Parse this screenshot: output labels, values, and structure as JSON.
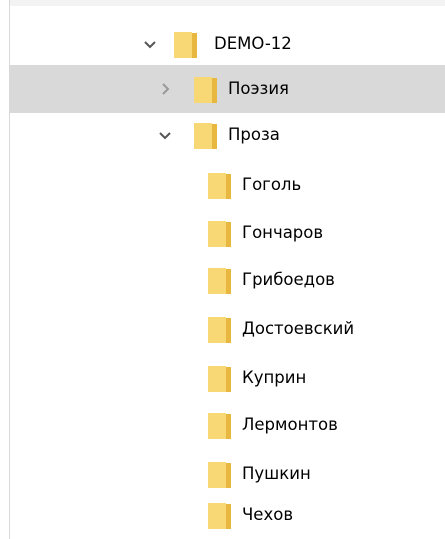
{
  "colors": {
    "selected_row": "#d9d9d9",
    "folder_fill": "#f8d775",
    "folder_tab": "#e8b73f",
    "chevron": "#555555"
  },
  "tree": {
    "root": {
      "label": "DEMO-12",
      "expanded": true
    },
    "poetry": {
      "label": "Поэзия",
      "expanded": false,
      "selected": true
    },
    "prose": {
      "label": "Проза",
      "expanded": true,
      "children": [
        {
          "label": "Гоголь"
        },
        {
          "label": "Гончаров"
        },
        {
          "label": "Грибоедов"
        },
        {
          "label": "Достоевский"
        },
        {
          "label": "Куприн"
        },
        {
          "label": "Лермонтов"
        },
        {
          "label": "Пушкин"
        },
        {
          "label": "Чехов"
        }
      ]
    }
  }
}
